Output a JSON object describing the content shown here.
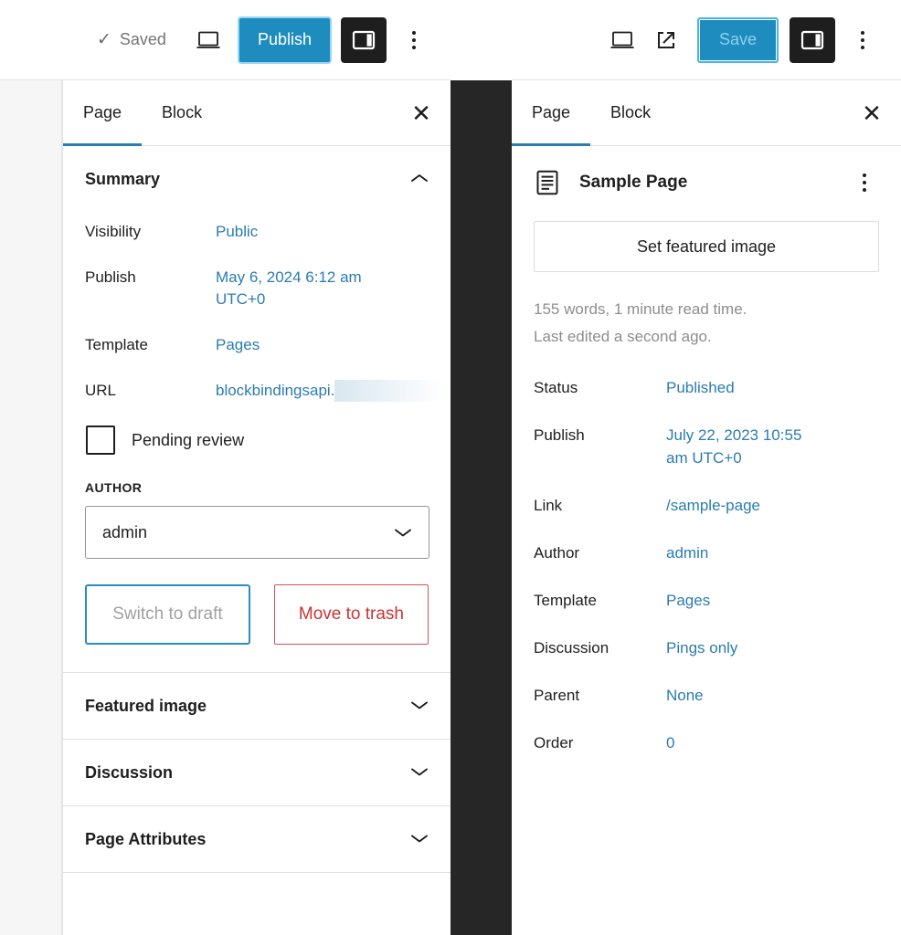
{
  "left": {
    "toolbar": {
      "saved_label": "Saved",
      "check_glyph": "✓",
      "preview_icon": "desktop-preview-icon",
      "publish_label": "Publish",
      "sidebar_toggle_icon": "sidebar-toggle-icon",
      "options_icon": "more-options-icon"
    },
    "tabs": [
      {
        "label": "Page",
        "active": true
      },
      {
        "label": "Block",
        "active": false
      }
    ],
    "close_glyph": "✕",
    "summary": {
      "title": "Summary",
      "rows": [
        {
          "label": "Visibility",
          "value": "Public"
        },
        {
          "label": "Publish",
          "value": "May 6, 2024 6:12 am UTC+0"
        },
        {
          "label": "Template",
          "value": "Pages"
        },
        {
          "label": "URL",
          "value": "blockbindingsapi."
        }
      ],
      "pending_review_label": "Pending review",
      "pending_review_checked": false,
      "author_label": "AUTHOR",
      "author_value": "admin",
      "switch_draft_label": "Switch to draft",
      "move_trash_label": "Move to trash"
    },
    "sections": [
      {
        "label": "Featured image"
      },
      {
        "label": "Discussion"
      },
      {
        "label": "Page Attributes"
      }
    ]
  },
  "right": {
    "toolbar": {
      "preview_icon": "desktop-preview-icon",
      "external_icon": "external-link-icon",
      "save_label": "Save",
      "sidebar_toggle_icon": "sidebar-toggle-icon",
      "options_icon": "more-options-icon"
    },
    "tabs": [
      {
        "label": "Page",
        "active": true
      },
      {
        "label": "Block",
        "active": false
      }
    ],
    "close_glyph": "✕",
    "document": {
      "icon": "page-document-icon",
      "title": "Sample Page",
      "options_icon": "more-options-icon",
      "featured_image_label": "Set featured image",
      "stats_line1": "155 words, 1 minute read time.",
      "stats_line2": "Last edited a second ago."
    },
    "meta_rows": [
      {
        "label": "Status",
        "value": "Published"
      },
      {
        "label": "Publish",
        "value": "July 22, 2023 10:55 am UTC+0"
      },
      {
        "label": "Link",
        "value": "/sample-page"
      },
      {
        "label": "Author",
        "value": "admin"
      },
      {
        "label": "Template",
        "value": "Pages"
      },
      {
        "label": "Discussion",
        "value": "Pings only"
      },
      {
        "label": "Parent",
        "value": "None"
      },
      {
        "label": "Order",
        "value": "0"
      }
    ]
  },
  "colors": {
    "accent_blue": "#2b7cb0",
    "publish_blue": "#1e8cbe",
    "danger_red": "#cc3333",
    "dark": "#1e1e1e",
    "muted": "#8d8d8d"
  }
}
